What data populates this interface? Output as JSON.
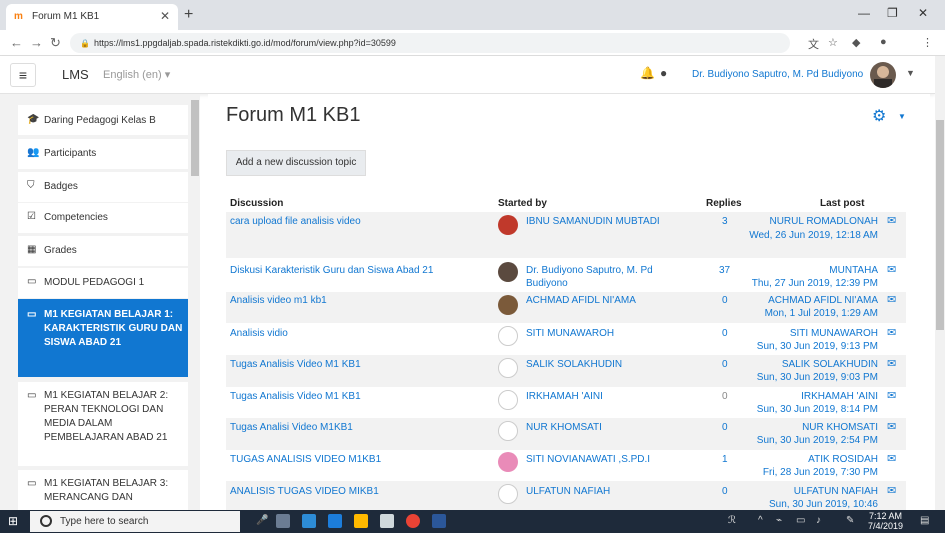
{
  "browser": {
    "tab_title": "Forum M1 KB1",
    "url": "https://lms1.ppgdaljab.spada.ristekdikti.go.id/mod/forum/view.php?id=30599"
  },
  "navbar": {
    "brand": "LMS",
    "language": "English (en) ▾",
    "user_name": "Dr. Budiyono Saputro, M. Pd Budiyono"
  },
  "drawer": {
    "items": [
      {
        "label": "Daring Pedagogi Kelas B",
        "icon": "graduation-cap-icon"
      },
      {
        "label": "Participants",
        "icon": "users-icon"
      },
      {
        "label": "Badges",
        "icon": "shield-icon"
      },
      {
        "label": "Competencies",
        "icon": "check-square-icon"
      },
      {
        "label": "Grades",
        "icon": "table-icon"
      },
      {
        "label": "MODUL PEDAGOGI 1",
        "icon": "folder-icon"
      },
      {
        "label": "M1 KEGIATAN BELAJAR 1: KARAKTERISTIK GURU DAN SISWA ABAD 21",
        "icon": "folder-icon"
      },
      {
        "label": "M1 KEGIATAN BELAJAR 2: PERAN TEKNOLOGI DAN MEDIA DALAM PEMBELAJARAN ABAD 21",
        "icon": "folder-icon"
      },
      {
        "label": "M1 KEGIATAN BELAJAR 3: MERANCANG DAN",
        "icon": "folder-icon"
      }
    ]
  },
  "main": {
    "title": "Forum M1 KB1",
    "add_button": "Add a new discussion topic",
    "headers": {
      "discussion": "Discussion",
      "started_by": "Started by",
      "replies": "Replies",
      "last_post": "Last post"
    },
    "rows": [
      {
        "discussion": "cara upload file analisis video",
        "started_by": "IBNU SAMANUDIN MUBTADI",
        "replies": "3",
        "last_user": "NURUL ROMADLONAH",
        "last_date": "Wed, 26 Jun 2019, 12:18 AM"
      },
      {
        "discussion": "Diskusi Karakteristik Guru dan Siswa Abad 21",
        "started_by": "Dr. Budiyono Saputro, M. Pd Budiyono",
        "replies": "37",
        "last_user": "MUNTAHA",
        "last_date": "Thu, 27 Jun 2019, 12:39 PM"
      },
      {
        "discussion": "Analisis video m1 kb1",
        "started_by": "ACHMAD AFIDL NI'AMA",
        "replies": "0",
        "last_user": "ACHMAD AFIDL NI'AMA",
        "last_date": "Mon, 1 Jul 2019, 1:29 AM"
      },
      {
        "discussion": "Analisis vidio",
        "started_by": "SITI MUNAWAROH",
        "replies": "0",
        "last_user": "SITI MUNAWAROH",
        "last_date": "Sun, 30 Jun 2019, 9:13 PM"
      },
      {
        "discussion": "Tugas Analisis Video M1 KB1",
        "started_by": "SALIK SOLAKHUDIN",
        "replies": "0",
        "last_user": "SALIK SOLAKHUDIN",
        "last_date": "Sun, 30 Jun 2019, 9:03 PM"
      },
      {
        "discussion": "Tugas Analisis Video M1 KB1",
        "started_by": "IRKHAMAH 'AINI",
        "replies": "0",
        "last_user": "IRKHAMAH 'AINI",
        "last_date": "Sun, 30 Jun 2019, 8:14 PM"
      },
      {
        "discussion": "Tugas Analisi Video M1KB1",
        "started_by": "NUR KHOMSATI",
        "replies": "0",
        "last_user": "NUR KHOMSATI",
        "last_date": "Sun, 30 Jun 2019, 2:54 PM"
      },
      {
        "discussion": "TUGAS ANALISIS VIDEO M1KB1",
        "started_by": "SITI NOVIANAWATI ,S.PD.I",
        "replies": "1",
        "last_user": "ATIK ROSIDAH",
        "last_date": "Fri, 28 Jun 2019, 7:30 PM"
      },
      {
        "discussion": "ANALISIS TUGAS VIDEO MIKB1",
        "started_by": "ULFATUN NAFIAH",
        "replies": "0",
        "last_user": "ULFATUN NAFIAH",
        "last_date": "Sun, 30 Jun 2019, 10:46"
      }
    ]
  },
  "taskbar": {
    "search_placeholder": "Type here to search",
    "time": "7:12 AM",
    "date": "7/4/2019"
  }
}
